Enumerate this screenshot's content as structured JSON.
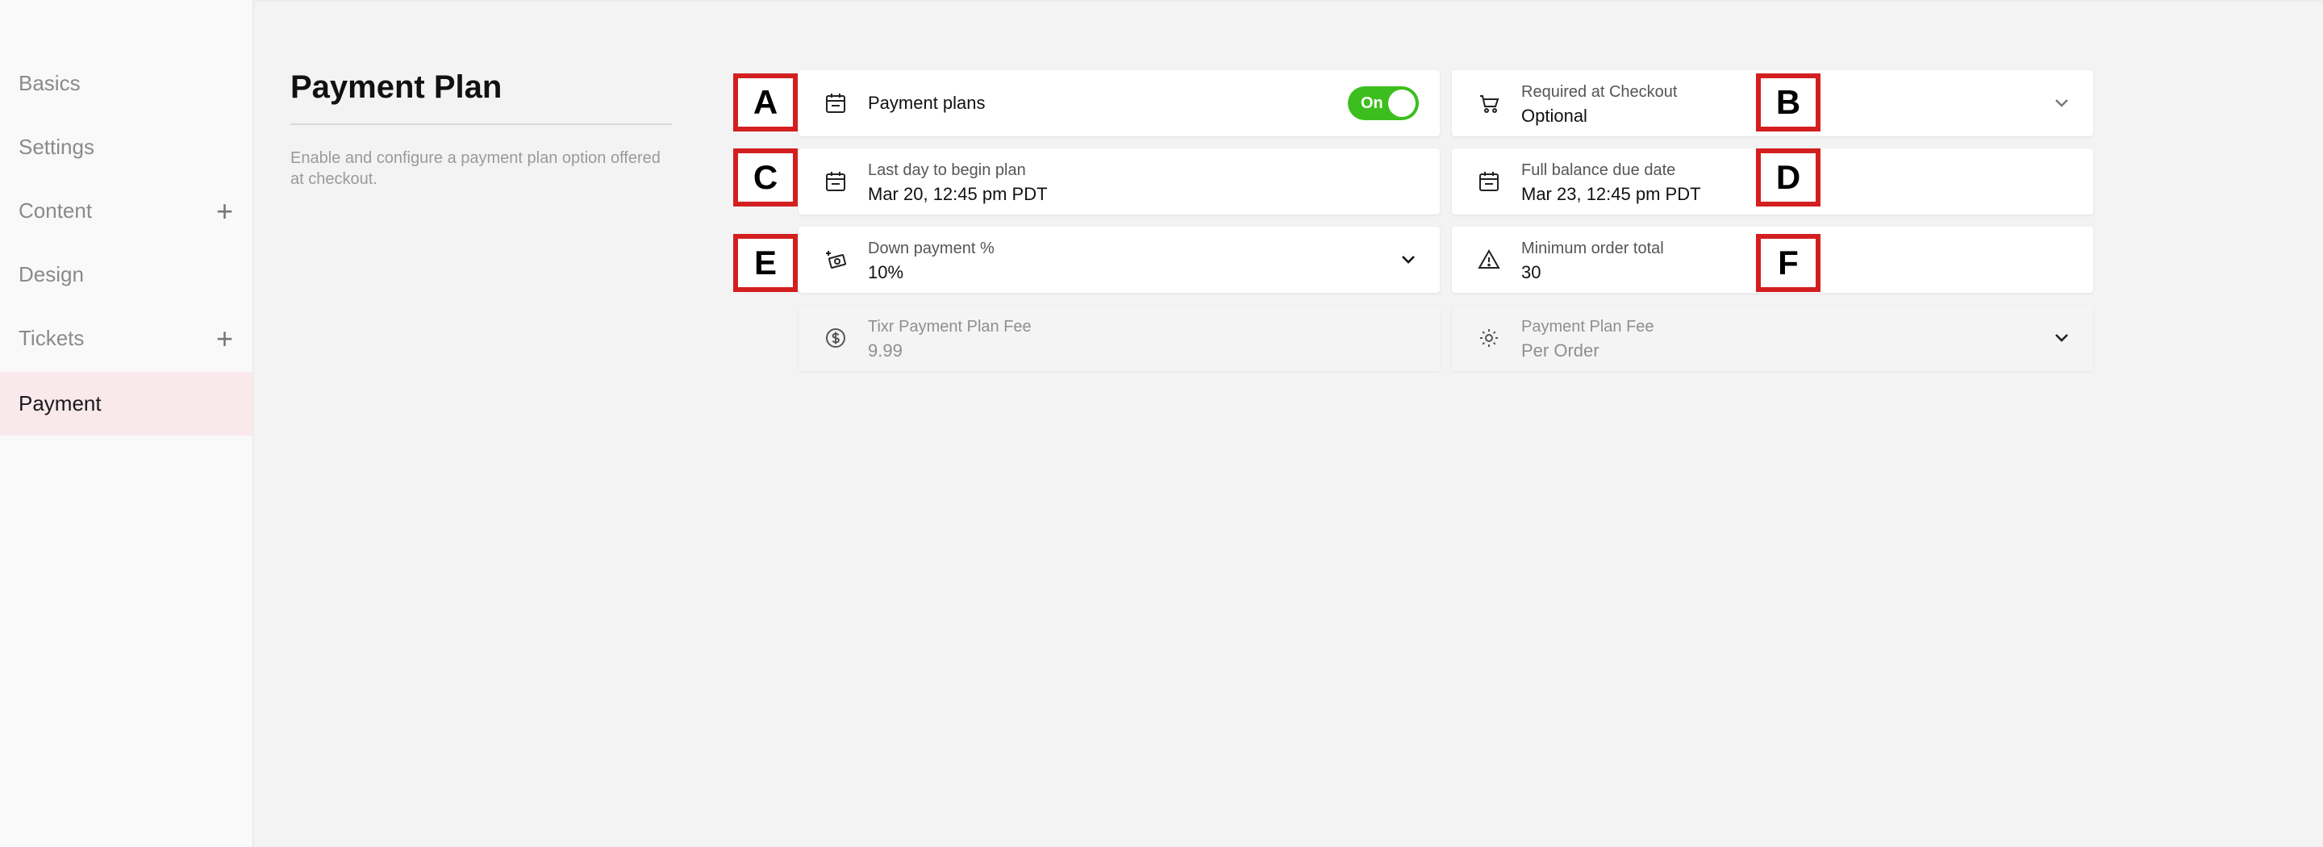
{
  "sidebar": {
    "items": [
      {
        "label": "Basics"
      },
      {
        "label": "Settings"
      },
      {
        "label": "Content",
        "expand": "+"
      },
      {
        "label": "Design"
      },
      {
        "label": "Tickets",
        "expand": "+"
      },
      {
        "label": "Payment"
      }
    ],
    "active": "Payment"
  },
  "main": {
    "title": "Payment Plan",
    "description": "Enable and configure a payment plan option offered at checkout."
  },
  "fields": {
    "payment_plans": {
      "label": "Payment plans",
      "toggle_text": "On",
      "enabled": true
    },
    "required_checkout": {
      "label": "Required at Checkout",
      "value": "Optional"
    },
    "last_day": {
      "label": "Last day to begin plan",
      "value": "Mar 20, 12:45 pm PDT"
    },
    "full_balance": {
      "label": "Full balance due date",
      "value": "Mar 23, 12:45 pm PDT"
    },
    "down_payment": {
      "label": "Down payment %",
      "value": "10%"
    },
    "min_order": {
      "label": "Minimum order total",
      "value": "30"
    },
    "tixr_fee": {
      "label": "Tixr Payment Plan Fee",
      "value": "9.99"
    },
    "plan_fee": {
      "label": "Payment Plan Fee",
      "value": "Per Order"
    }
  },
  "markers": {
    "a": "A",
    "b": "B",
    "c": "C",
    "d": "D",
    "e": "E",
    "f": "F"
  },
  "colors": {
    "toggle_on": "#3cbf1e",
    "marker_border": "#d31f1f",
    "active_nav_bg": "#f9e9ec"
  }
}
